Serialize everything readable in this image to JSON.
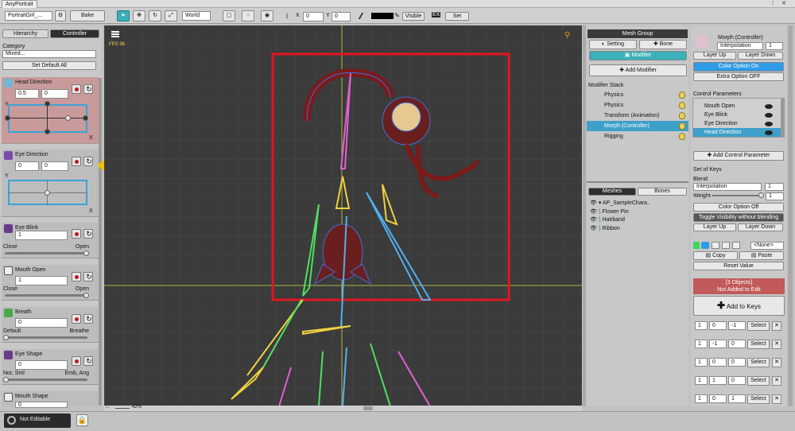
{
  "app": {
    "title": "AnyPortrait"
  },
  "toolbar": {
    "portrait": "PortraitGirl_...",
    "bake": "Bake",
    "space": "World",
    "x_label": "X",
    "x": "0",
    "y_label": "Y",
    "y": "0",
    "visible": "Visible",
    "set": "Set"
  },
  "left": {
    "tabs": [
      "Hierarchy",
      "Controller"
    ],
    "category_label": "Category",
    "category_value": "Mixed...",
    "set_default_all": "Set Default All",
    "controls": [
      {
        "name": "Head Direction",
        "v1": "0.5",
        "v2": "0",
        "ylabel": "Y",
        "xlabel": "X"
      },
      {
        "name": "Eye Direction",
        "v1": "0",
        "v2": "0",
        "ylabel": "Y",
        "xlabel": "X"
      },
      {
        "name": "Eye Blink",
        "v1": "1",
        "min": "Close",
        "max": "Open"
      },
      {
        "name": "Mouth Open",
        "v1": "1",
        "min": "Close",
        "max": "Open"
      },
      {
        "name": "Breath",
        "v1": "0",
        "min": "Default",
        "max": "Breathe"
      },
      {
        "name": "Eye Shape",
        "v1": "0",
        "min": "Nor, Sml",
        "max": "Emb, Ang"
      },
      {
        "name": "Mouth Shape",
        "v1": "0"
      }
    ]
  },
  "annotation": {
    "number": "1"
  },
  "viewport": {
    "fps": "FPS 96",
    "zoom": "42%"
  },
  "middle": {
    "title": "Mesh Group",
    "setting": "Setting",
    "bone": "Bone",
    "modifier": "Modifier",
    "add_modifier": "Add Modifier",
    "stack_label": "Modifier Stack",
    "stack": [
      "Physics",
      "Physics",
      "Transform (Animation)",
      "Morph (Controller)",
      "Rigging"
    ],
    "tabs": [
      "Meshes",
      "Bones"
    ],
    "tree_root": "AP_SampleChara..",
    "tree": [
      "Flower Pin",
      "Hairband",
      "Ribbon"
    ]
  },
  "right": {
    "title": "Morph (Controller)",
    "mode": "Interpolation",
    "layer": "1",
    "layer_up": "Layer Up",
    "layer_down": "Layer Down",
    "color_on": "Color Option On",
    "extra_off": "Extra Option OFF",
    "params_label": "Control Parameters",
    "params": [
      "Mouth Open",
      "Eye Blink",
      "Eye Direction",
      "Head Direction"
    ],
    "add_param": "Add Control Parameter",
    "keys_label": "Set of Keys",
    "blend_label": "Blend",
    "blend_mode": "Interpolation",
    "blend_layer": "1",
    "weight_label": "Weight",
    "weight": "1",
    "color_off": "Color Option Off",
    "toggle_vis": "Toggle Visibility without blending",
    "layer_up2": "Layer Up",
    "layer_down2": "Layer Down",
    "none": "<None>",
    "copy": "Copy",
    "paste": "Paste",
    "reset": "Reset Value",
    "warn1": "[3 Objects]",
    "warn2": "Not Added to Edit",
    "add_keys": "Add to Keys",
    "keys": [
      {
        "a": "1",
        "b": "0",
        "c": "-1",
        "sel": "Select"
      },
      {
        "a": "1",
        "b": "-1",
        "c": "0",
        "sel": "Select"
      },
      {
        "a": "1",
        "b": "0",
        "c": "0",
        "sel": "Select"
      },
      {
        "a": "1",
        "b": "1",
        "c": "0",
        "sel": "Select"
      },
      {
        "a": "1",
        "b": "0",
        "c": "1",
        "sel": "Select"
      }
    ]
  },
  "status": {
    "text": "Not Editable"
  }
}
